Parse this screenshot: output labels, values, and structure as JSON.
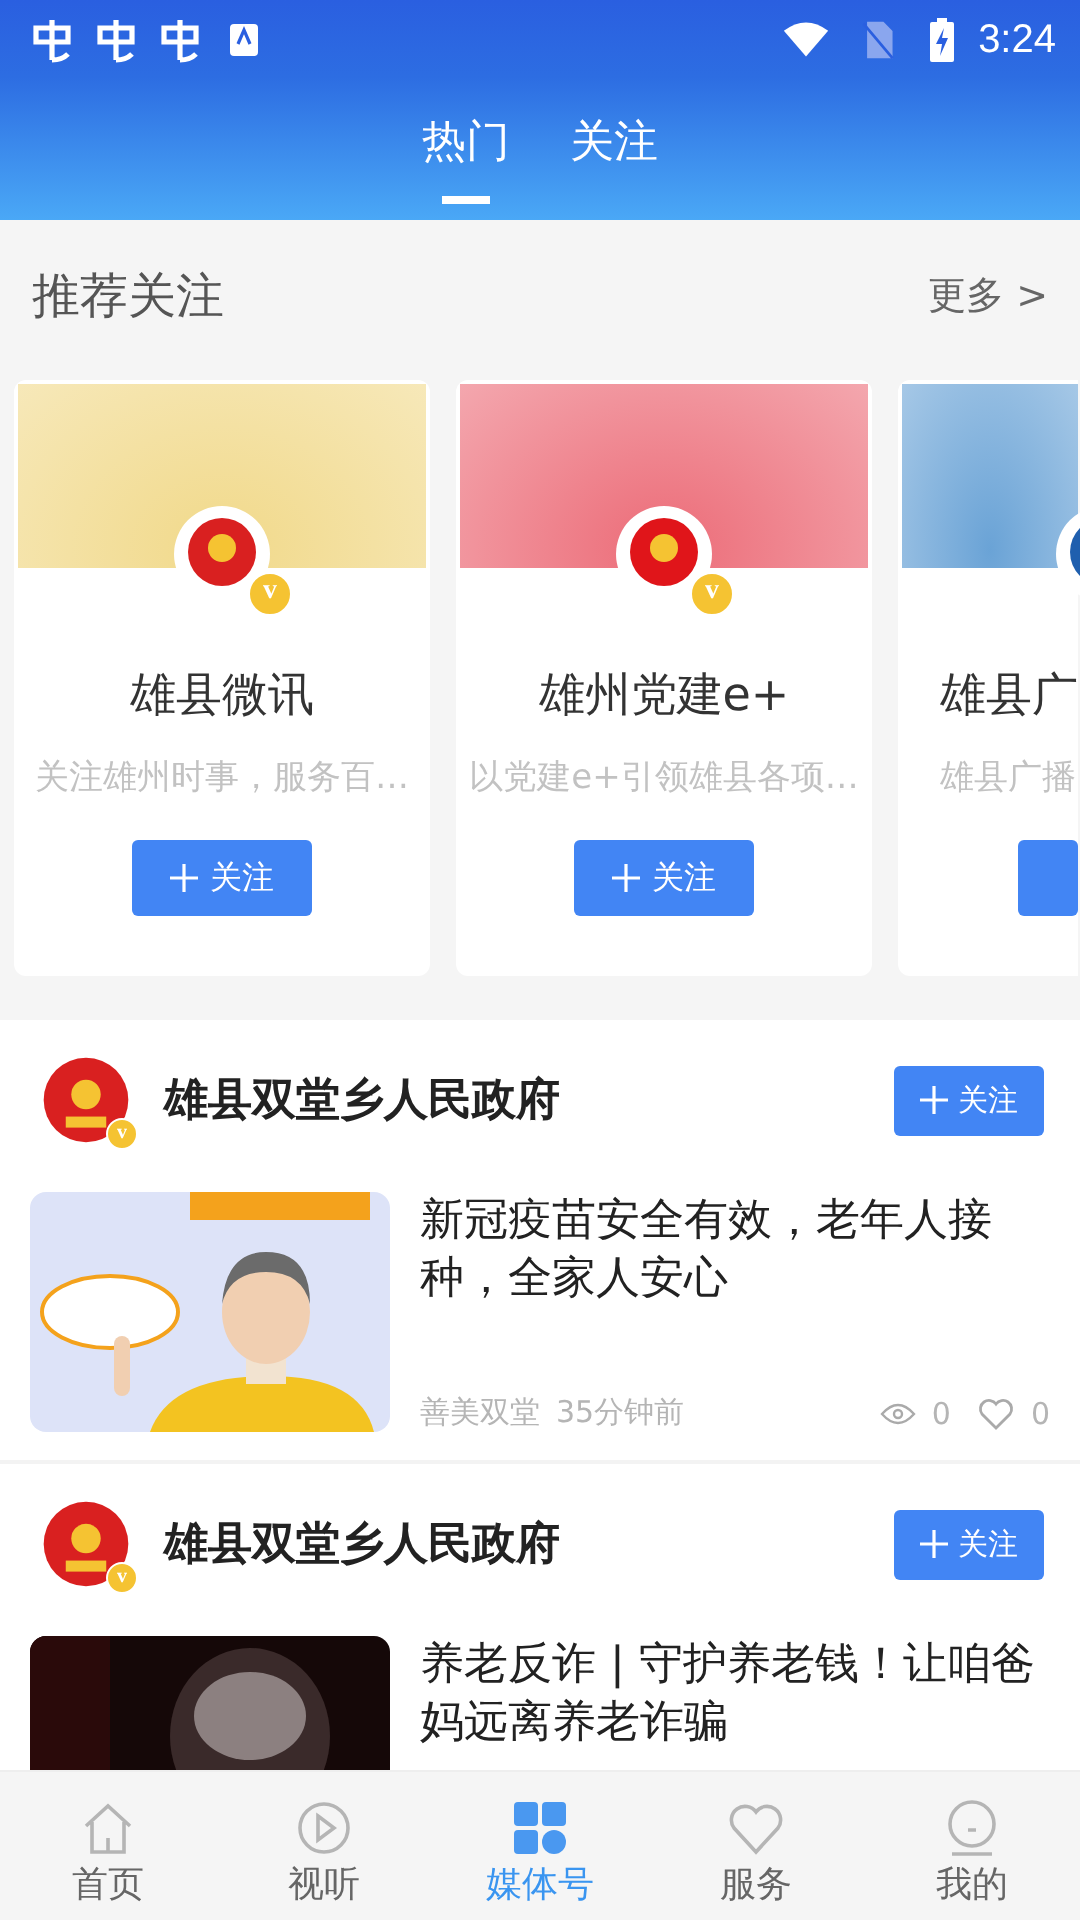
{
  "status_bar": {
    "time": "3:24"
  },
  "tabs": [
    {
      "label": "热门",
      "selected": true
    },
    {
      "label": "关注",
      "selected": false
    }
  ],
  "recommend": {
    "title": "推荐关注",
    "more": "更多 >",
    "cards": [
      {
        "name": "雄县微讯",
        "desc": "关注雄州时事，服务百…",
        "follow": "关注",
        "verified": "v"
      },
      {
        "name": "雄州党建e+",
        "desc": "以党建e+引领雄县各项…",
        "follow": "关注",
        "verified": "v"
      },
      {
        "name": "雄县广",
        "desc": "雄县广播"
      }
    ]
  },
  "posts": [
    {
      "account": "雄县双堂乡人民政府",
      "verified": "v",
      "follow": "关注",
      "article": {
        "title": "新冠疫苗安全有效，老年人接种，全家人安心",
        "source": "善美双堂",
        "time": "35分钟前",
        "views": "0",
        "likes": "0",
        "kind": "bright"
      }
    },
    {
      "account": "雄县双堂乡人民政府",
      "verified": "v",
      "follow": "关注",
      "article": {
        "title": "养老反诈 | 守护养老钱！让咱爸妈远离养老诈骗",
        "kind": "dark"
      }
    }
  ],
  "nav": [
    {
      "label": "首页",
      "kind": "home",
      "selected": false
    },
    {
      "label": "视听",
      "kind": "play",
      "selected": false
    },
    {
      "label": "媒体号",
      "kind": "media",
      "selected": true
    },
    {
      "label": "服务",
      "kind": "heart",
      "selected": false
    },
    {
      "label": "我的",
      "kind": "user",
      "selected": false
    }
  ]
}
